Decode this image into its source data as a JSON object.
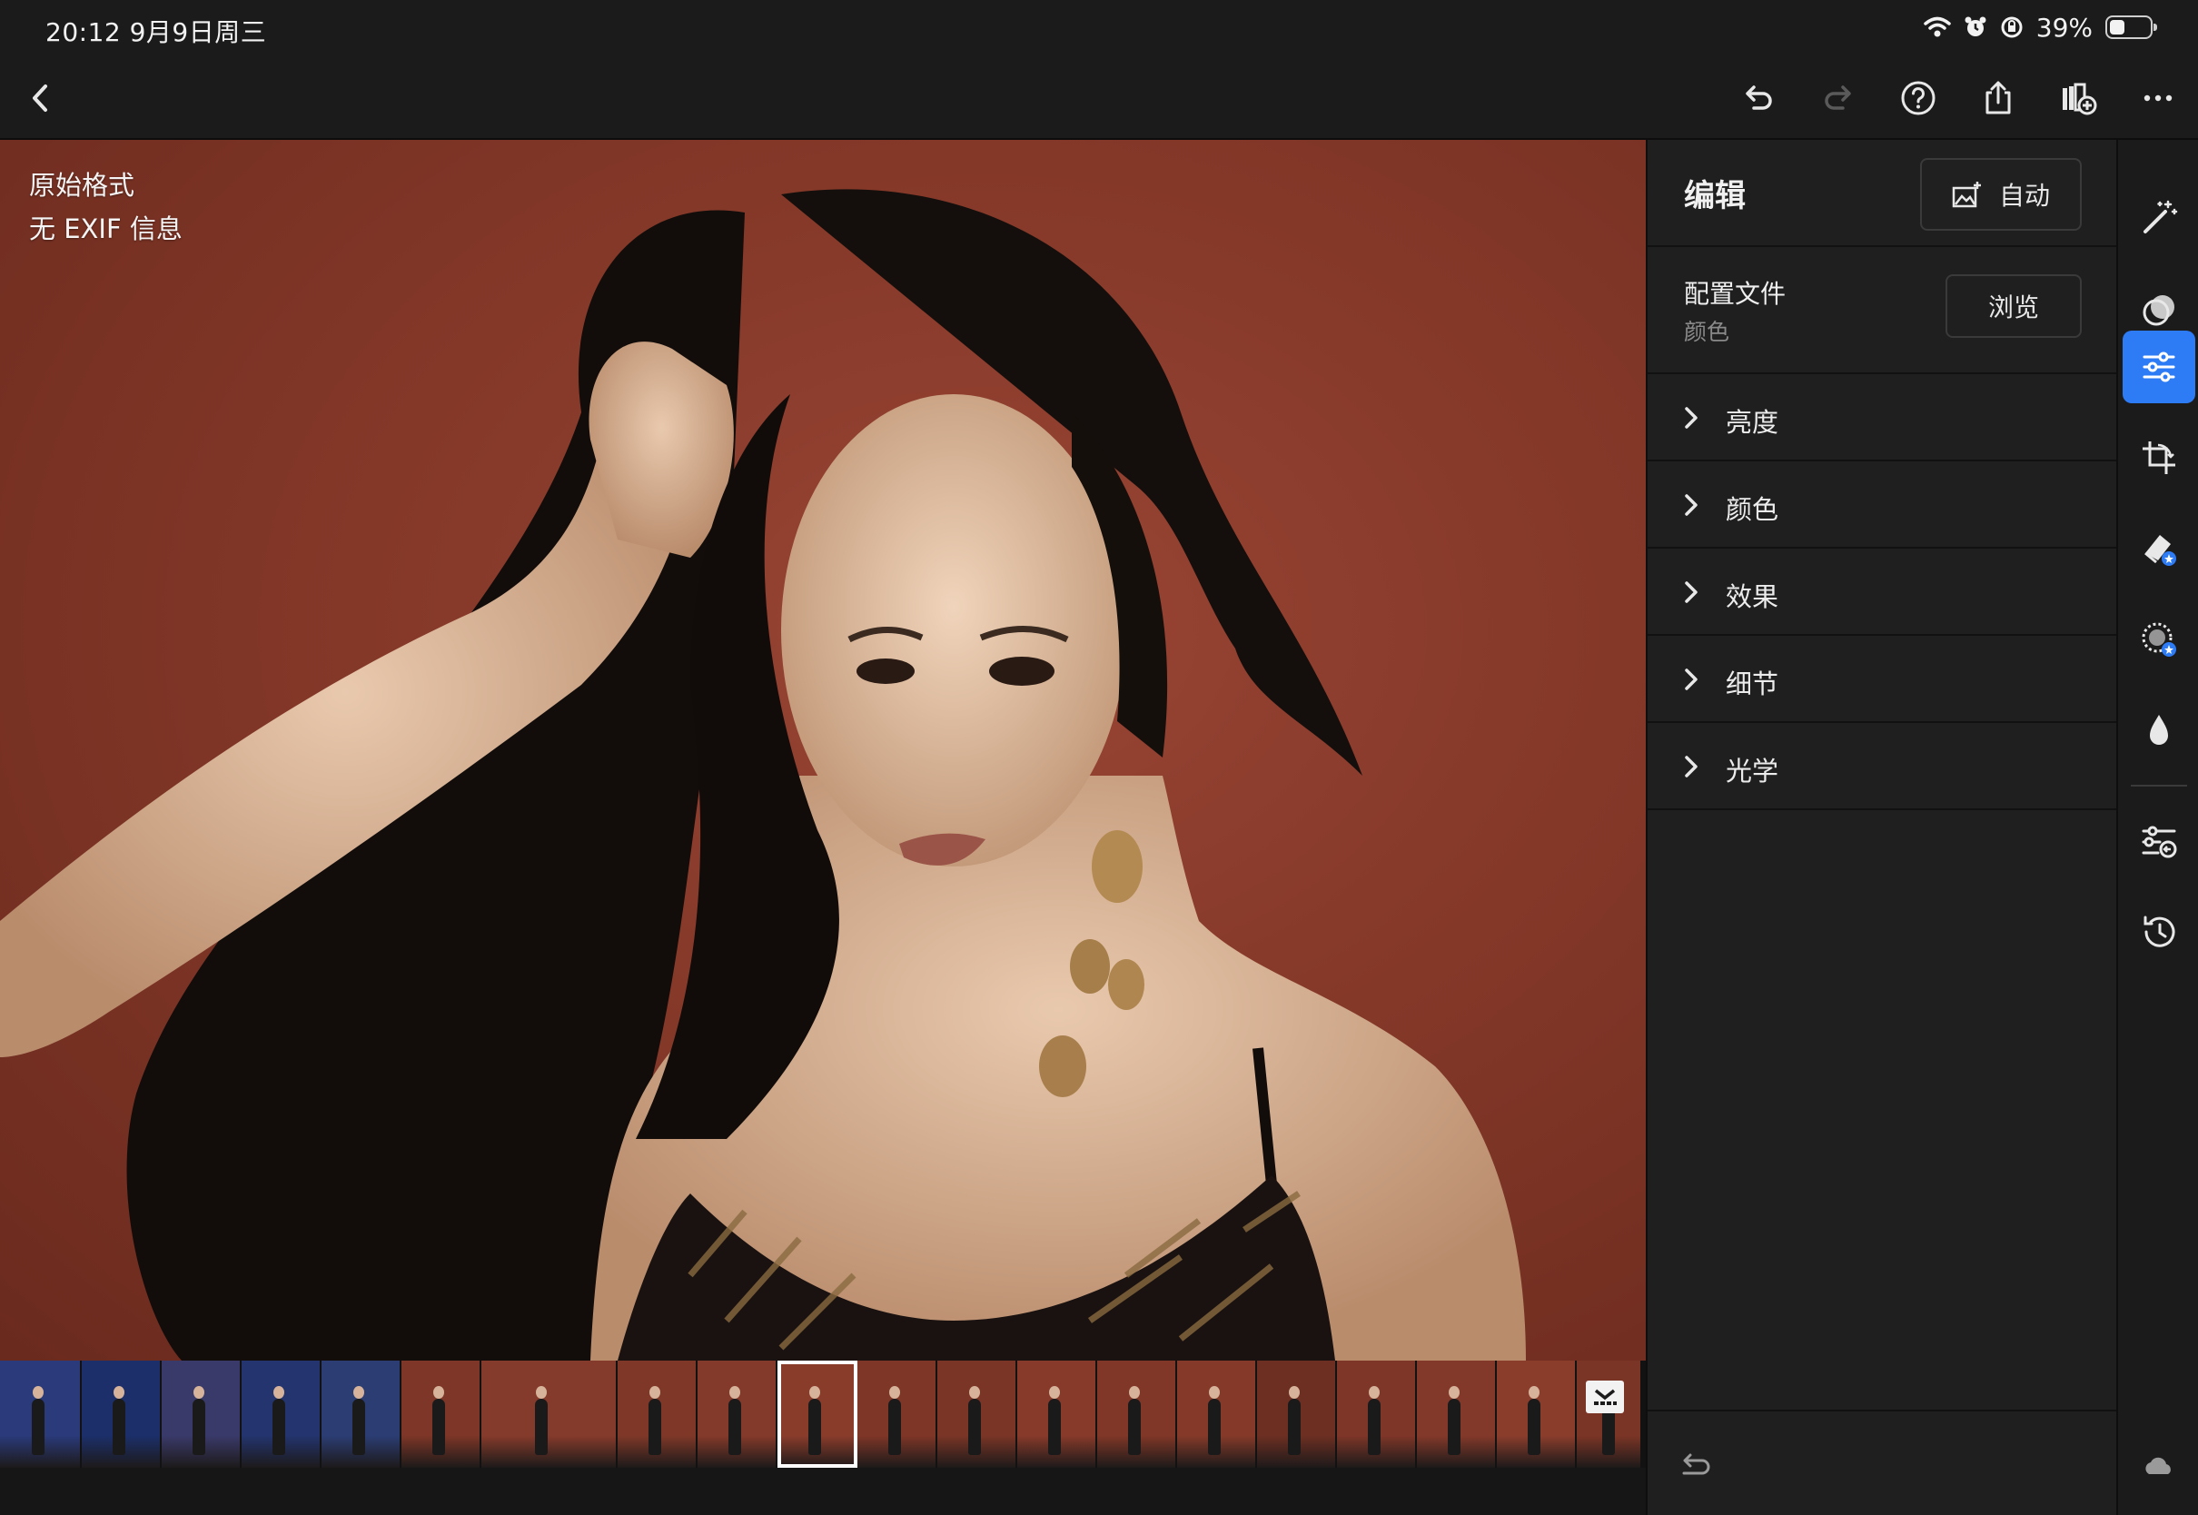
{
  "status_bar": {
    "time_date": "20:12   9月9日周三",
    "battery_text": "39%",
    "battery_level": 0.39
  },
  "toolbar": {
    "back_icon": "chevron-left-icon",
    "undo_icon": "undo-icon",
    "redo_icon": "redo-icon",
    "help_icon": "help-icon",
    "share_icon": "share-icon",
    "add_to_album_icon": "add-to-album-icon",
    "more_icon": "more-icon"
  },
  "photo": {
    "info_line1": "原始格式",
    "info_line2": "无 EXIF 信息"
  },
  "filmstrip": {
    "thumbs": [
      {
        "color": "#2a3a7a",
        "w": 90
      },
      {
        "color": "#1c2f6a",
        "w": 88
      },
      {
        "color": "#3a3a6a",
        "w": 88
      },
      {
        "color": "#23346e",
        "w": 88
      },
      {
        "color": "#2b3d73",
        "w": 88
      },
      {
        "color": "#7d3627",
        "w": 88
      },
      {
        "color": "#853b2b",
        "w": 150
      },
      {
        "color": "#7f3828",
        "w": 88
      },
      {
        "color": "#843a2a",
        "w": 88
      },
      {
        "color": "#8a3c2b",
        "w": 88
      },
      {
        "color": "#7e3627",
        "w": 88
      },
      {
        "color": "#7a3526",
        "w": 88
      },
      {
        "color": "#873a2a",
        "w": 88
      },
      {
        "color": "#803727",
        "w": 88
      },
      {
        "color": "#853a29",
        "w": 88
      },
      {
        "color": "#6d2f22",
        "w": 88
      },
      {
        "color": "#7e3628",
        "w": 88
      },
      {
        "color": "#83392a",
        "w": 88
      },
      {
        "color": "#8b3d2c",
        "w": 88
      },
      {
        "color": "#7b3526",
        "w": 72
      }
    ],
    "selected_index": 9
  },
  "panel": {
    "title": "编辑",
    "auto_label": "自动",
    "profile_title": "配置文件",
    "profile_value": "颜色",
    "browse_label": "浏览",
    "sections": [
      "亮度",
      "颜色",
      "效果",
      "细节",
      "光学"
    ]
  },
  "rail": {
    "tools": [
      "magic-wand-icon",
      "presets-icon",
      "edit-sliders-icon",
      "crop-icon",
      "healing-icon",
      "masking-icon",
      "blur-icon",
      "versions-icon",
      "history-icon"
    ],
    "active_tool": "edit-sliders-icon",
    "accent": "#2d7cf6"
  }
}
